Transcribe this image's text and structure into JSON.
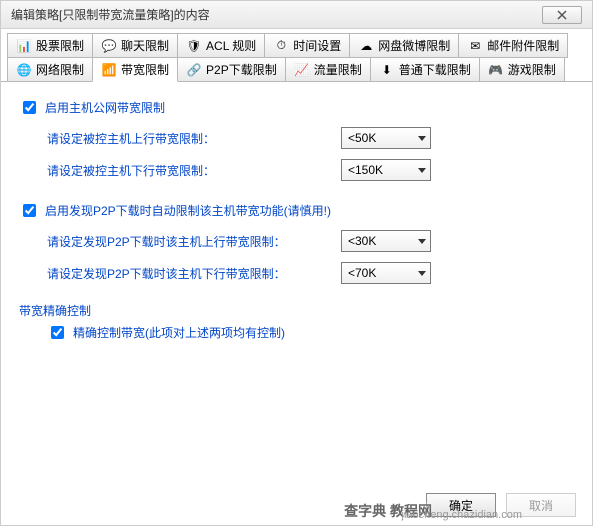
{
  "title": "编辑策略[只限制带宽流量策略]的内容",
  "tabs": {
    "row1": [
      {
        "label": "股票限制",
        "icon": "chart-icon"
      },
      {
        "label": "聊天限制",
        "icon": "chat-icon"
      },
      {
        "label": "ACL 规则",
        "icon": "shield-icon"
      },
      {
        "label": "时间设置",
        "icon": "clock-icon"
      },
      {
        "label": "网盘微博限制",
        "icon": "cloud-icon"
      },
      {
        "label": "邮件附件限制",
        "icon": "mail-icon"
      }
    ],
    "row2": [
      {
        "label": "网络限制",
        "icon": "globe-icon"
      },
      {
        "label": "带宽限制",
        "icon": "speed-icon",
        "active": true
      },
      {
        "label": "P2P下载限制",
        "icon": "p2p-icon"
      },
      {
        "label": "流量限制",
        "icon": "bars-icon"
      },
      {
        "label": "普通下载限制",
        "icon": "download-icon"
      },
      {
        "label": "游戏限制",
        "icon": "game-icon"
      }
    ]
  },
  "section1": {
    "checkbox": "启用主机公网带宽限制",
    "up_label": "请设定被控主机上行带宽限制：",
    "up_value": "<50K",
    "down_label": "请设定被控主机下行带宽限制：",
    "down_value": "<150K"
  },
  "section2": {
    "checkbox": "启用发现P2P下载时自动限制该主机带宽功能(请慎用!)",
    "up_label": "请设定发现P2P下载时该主机上行带宽限制：",
    "up_value": "<30K",
    "down_label": "请设定发现P2P下载时该主机下行带宽限制：",
    "down_value": "<70K"
  },
  "section3": {
    "title": "带宽精确控制",
    "checkbox": "精确控制带宽(此项对上述两项均有控制)"
  },
  "buttons": {
    "ok": "确定",
    "cancel": "取消"
  },
  "watermark": "jiaocheng.chazidian.com",
  "watermark2": "查字典 教程网",
  "icons": {
    "chart-icon": "📊",
    "chat-icon": "💬",
    "shield-icon": "🛡",
    "clock-icon": "⏱",
    "cloud-icon": "☁",
    "mail-icon": "✉",
    "globe-icon": "🌐",
    "speed-icon": "📶",
    "p2p-icon": "🔗",
    "bars-icon": "📈",
    "download-icon": "⬇",
    "game-icon": "🎮"
  }
}
